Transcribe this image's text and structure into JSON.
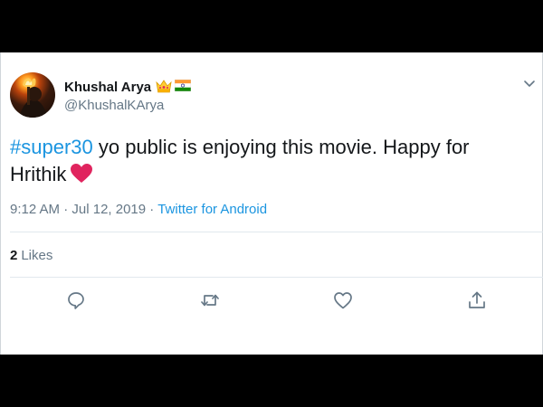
{
  "tweet": {
    "display_name": "Khushal Arya",
    "handle": "@KhushalKArya",
    "text_hashtag": "#super30",
    "text_rest": " yo public is enjoying this movie. Happy for Hrithik",
    "time": "9:12 AM",
    "separator": " · ",
    "date": "Jul 12, 2019",
    "source": "Twitter for Android",
    "likes_count": "2",
    "likes_label": "Likes"
  },
  "icons": {
    "name_emojis": [
      "crown-icon",
      "india-flag-icon"
    ],
    "text_emoji": "red-heart-icon",
    "caret": "chevron-down-icon",
    "actions": [
      "reply-icon",
      "retweet-icon",
      "like-icon",
      "share-icon"
    ]
  },
  "colors": {
    "link": "#1b95e0",
    "secondary_text": "#657786",
    "primary_text": "#14171a",
    "heart": "#e0245e"
  }
}
